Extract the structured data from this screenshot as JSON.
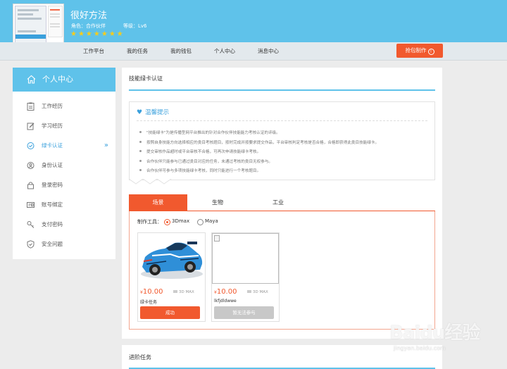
{
  "header": {
    "username": "很好方法",
    "role": "角色：合作伙伴",
    "level": "等级：Lv6",
    "stars": "★★★★★★★",
    "nav": [
      "工作平台",
      "我的任务",
      "我的钱包",
      "个人中心",
      "消息中心"
    ],
    "pack_button": "抢包制作",
    "pack_icon": "!"
  },
  "sidebar": {
    "title": "个人中心",
    "items": [
      {
        "label": "工作经历",
        "icon": "clipboard-icon"
      },
      {
        "label": "学习经历",
        "icon": "edit-icon"
      },
      {
        "label": "绿卡认证",
        "icon": "check-circle-icon",
        "active": true
      },
      {
        "label": "身份认证",
        "icon": "id-icon"
      },
      {
        "label": "登录密码",
        "icon": "lock-icon"
      },
      {
        "label": "账号绑定",
        "icon": "card-icon"
      },
      {
        "label": "支付密码",
        "icon": "key-icon"
      },
      {
        "label": "安全问题",
        "icon": "shield-icon"
      }
    ],
    "active_arrow": "»"
  },
  "main": {
    "title": "技能绿卡认证",
    "tip_title": "温馨提示",
    "tip_heart": "♥",
    "tips": [
      "\"技能绿卡\"为是传播型网平台推出的针对合作伙伴技能能力考核认证的评级。",
      "按照自身技能方向选择相应的类目考核题目，按时完成并按要求提交作品，平台审核判定考核是否合格，合格即获得此类目技能绿卡。",
      "提交审核作品超时或平台审核不合格，可再次申请技能绿卡考核。",
      "合作伙伴只能参与已通过类目对应的任务，未通过考核的类目无权参与。",
      "合作伙伴可参与多项技能绿卡考核，同时只能进行一个考核题目。"
    ],
    "tabs": [
      "场景",
      "生物",
      "工业"
    ],
    "active_tab": 0,
    "tool_label": "制作工具：",
    "tools": [
      "3Dmax",
      "Maya"
    ],
    "selected_tool": 0,
    "cards": [
      {
        "currency": "¥",
        "price": "10.00",
        "software": "3D MAX",
        "name": "绿卡任务",
        "button": "成功",
        "status": "ok",
        "image": "blue-race-car"
      },
      {
        "currency": "¥",
        "price": "10.00",
        "software": "3D MAX",
        "name": "lkfjdldwwe",
        "button": "暂无法参与",
        "status": "disabled",
        "image": "broken-image"
      }
    ],
    "next_section_title": "进阶任务"
  },
  "watermark": {
    "text": "Baidu经验",
    "url": "jingyan.baidu.com"
  },
  "colors": {
    "accent_blue": "#5fc2ea",
    "accent_orange": "#f1592e",
    "star_yellow": "#f5cc1c"
  }
}
